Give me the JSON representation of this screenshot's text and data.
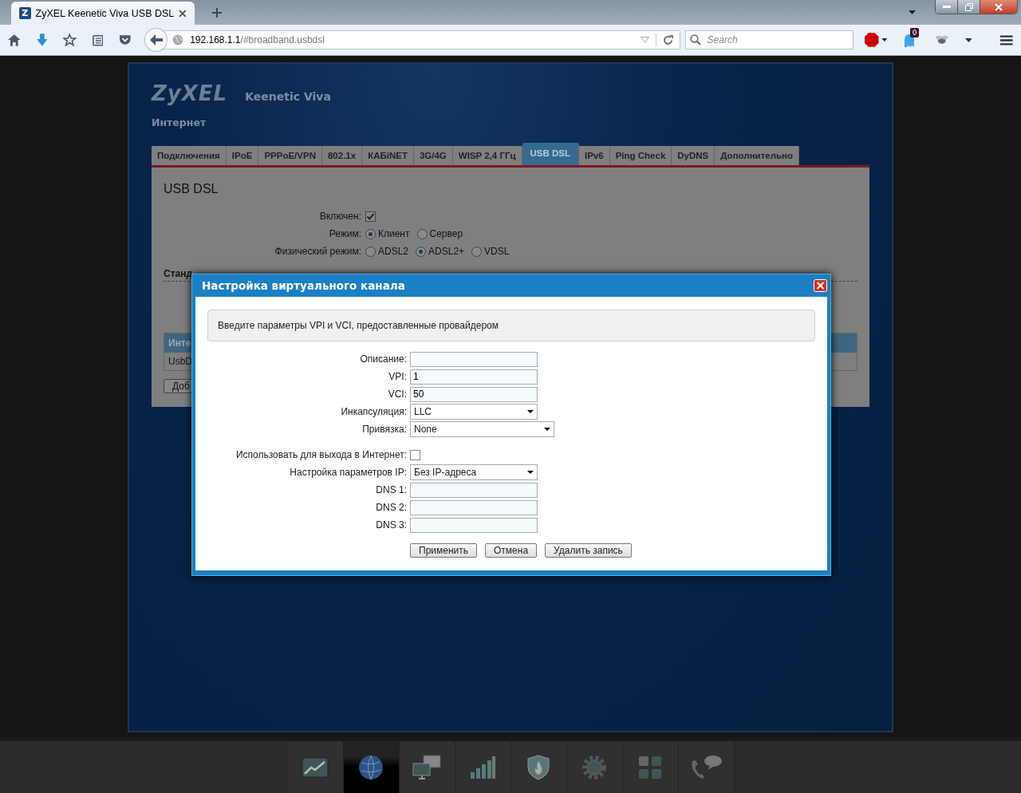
{
  "browser": {
    "favicon_letter": "Z",
    "tab_title": "ZyXEL Keenetic Viva USB DSL",
    "url_host": "192.168.1.1",
    "url_path": "/#broadband.usbdsl",
    "search_placeholder": "Search",
    "ghostery_count": "0"
  },
  "header": {
    "logo": "ZyXEL",
    "model": "Keenetic Viva",
    "section": "Интернет"
  },
  "tabs": [
    {
      "label": "Подключения",
      "selected": false
    },
    {
      "label": "IPoE",
      "selected": false
    },
    {
      "label": "PPPoE/VPN",
      "selected": false
    },
    {
      "label": "802.1x",
      "selected": false
    },
    {
      "label": "КАБiNET",
      "selected": false
    },
    {
      "label": "3G/4G",
      "selected": false
    },
    {
      "label": "WISP 2,4 ГГц",
      "selected": false
    },
    {
      "label": "USB DSL",
      "selected": true
    },
    {
      "label": "IPv6",
      "selected": false
    },
    {
      "label": "Ping Check",
      "selected": false
    },
    {
      "label": "DyDNS",
      "selected": false
    },
    {
      "label": "Дополнительно",
      "selected": false
    }
  ],
  "panel": {
    "title": "USB DSL",
    "enabled_label": "Включен:",
    "enabled": true,
    "mode_label": "Режим:",
    "modes": [
      {
        "label": "Клиент",
        "selected": true
      },
      {
        "label": "Сервер",
        "selected": false
      }
    ],
    "phys_label": "Физический режим:",
    "phys_modes": [
      {
        "label": "ADSL2",
        "selected": false
      },
      {
        "label": "ADSL2+",
        "selected": true
      },
      {
        "label": "VDSL",
        "selected": false
      }
    ],
    "section_partial": "Станд",
    "table_header_partial": "Инте",
    "table_cell_partial": "UsbD",
    "button_partial": "Доб"
  },
  "dialog": {
    "title": "Настройка виртуального канала",
    "info": "Введите параметры VPI и VCI, предоставленные провайдером",
    "fields": [
      {
        "kind": "text",
        "label": "Описание:"
      },
      {
        "kind": "text",
        "label": "VPI:",
        "value": "1"
      },
      {
        "kind": "text",
        "label": "VCI:",
        "value": "50"
      },
      {
        "kind": "select",
        "label": "Инкапсуляция:",
        "value": "LLC"
      },
      {
        "kind": "select_wide",
        "label": "Привязка:",
        "value": "None"
      },
      {
        "kind": "checkbox",
        "label": "Использовать для выхода в Интернет:",
        "checked": false
      },
      {
        "kind": "select",
        "label": "Настройка параметров IP:",
        "value": "Без IP-адреса"
      },
      {
        "kind": "text",
        "label": "DNS 1:"
      },
      {
        "kind": "text",
        "label": "DNS 2:"
      },
      {
        "kind": "text",
        "label": "DNS 3:"
      }
    ],
    "buttons": [
      "Применить",
      "Отмена",
      "Удалить запись"
    ]
  },
  "dock": [
    {
      "kind": "chart",
      "selected": false
    },
    {
      "kind": "globe",
      "selected": true
    },
    {
      "kind": "monitors",
      "selected": false
    },
    {
      "kind": "signal",
      "selected": false
    },
    {
      "kind": "shield",
      "selected": false
    },
    {
      "kind": "gear",
      "selected": false
    },
    {
      "kind": "apps",
      "selected": false
    },
    {
      "kind": "phone",
      "selected": false
    }
  ]
}
